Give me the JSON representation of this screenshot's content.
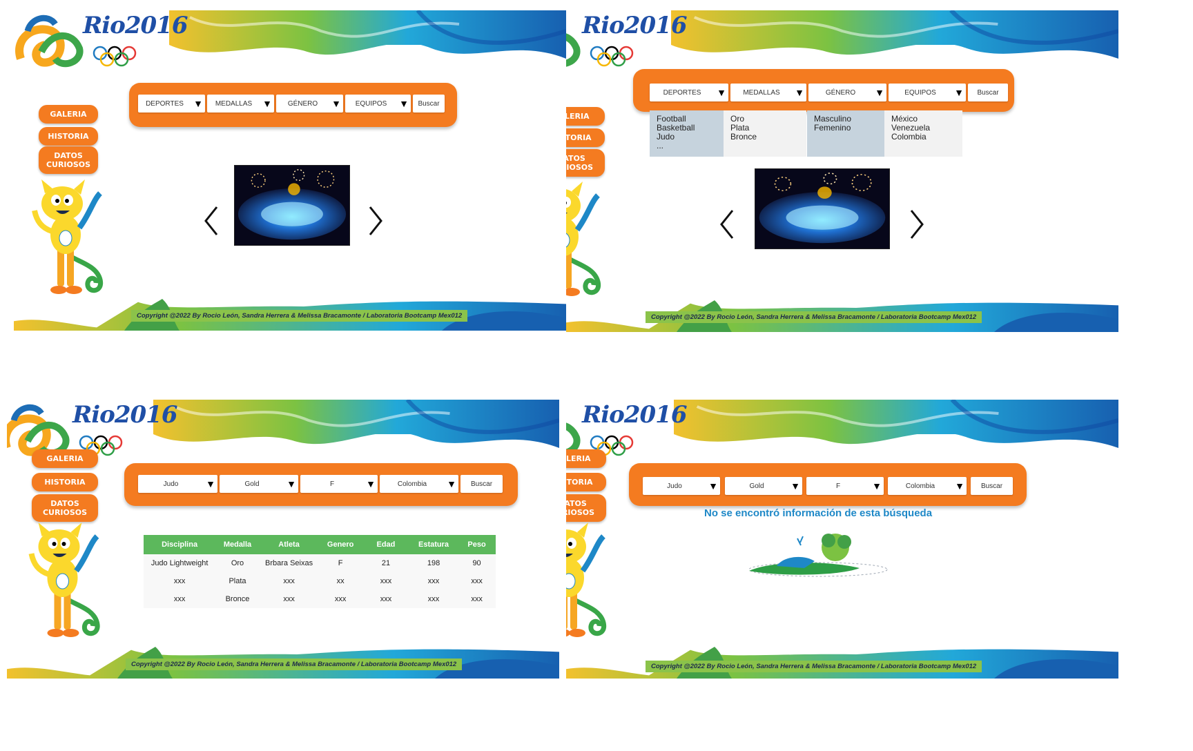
{
  "brand": {
    "logo_text": "Rio2016"
  },
  "nav": {
    "galeria": "GALERIA",
    "historia": "HISTORIA",
    "datos": "DATOS CURIOSOS"
  },
  "filters_default": {
    "deportes": "DEPORTES",
    "medallas": "MEDALLAS",
    "genero": "GÉNERO",
    "equipos": "EQUIPOS",
    "buscar": "Buscar"
  },
  "filters_selected": {
    "deporte": "Judo",
    "medalla": "Gold",
    "genero": "F",
    "equipo": "Colombia",
    "buscar": "Buscar"
  },
  "dropdown": {
    "deportes": [
      "Football",
      "Basketball",
      "Judo",
      "..."
    ],
    "medallas": [
      "Oro",
      "Plata",
      "Bronce"
    ],
    "genero": [
      "Masculino",
      "Femenino"
    ],
    "equipos": [
      "México",
      "Venezuela",
      "Colombia"
    ]
  },
  "results_table": {
    "headers": [
      "Disciplina",
      "Medalla",
      "Atleta",
      "Genero",
      "Edad",
      "Estatura",
      "Peso"
    ],
    "rows": [
      [
        "Judo Lightweight",
        "Oro",
        "Brbara Seixas",
        "F",
        "21",
        "198",
        "90"
      ],
      [
        "xxx",
        "Plata",
        "xxx",
        "xx",
        "xxx",
        "xxx",
        "xxx"
      ],
      [
        "xxx",
        "Bronce",
        "xxx",
        "xxx",
        "xxx",
        "xxx",
        "xxx"
      ]
    ]
  },
  "no_result_message": "No se encontró información de esta búsqueda",
  "copyright": "Copyright @2022 By Rocio León, Sandra Herrera & Melissa Bracamonte / Laboratoria Bootcamp Mex012",
  "colors": {
    "orange": "#f47b20",
    "green": "#5cb85c",
    "blue": "#1e88c7"
  }
}
